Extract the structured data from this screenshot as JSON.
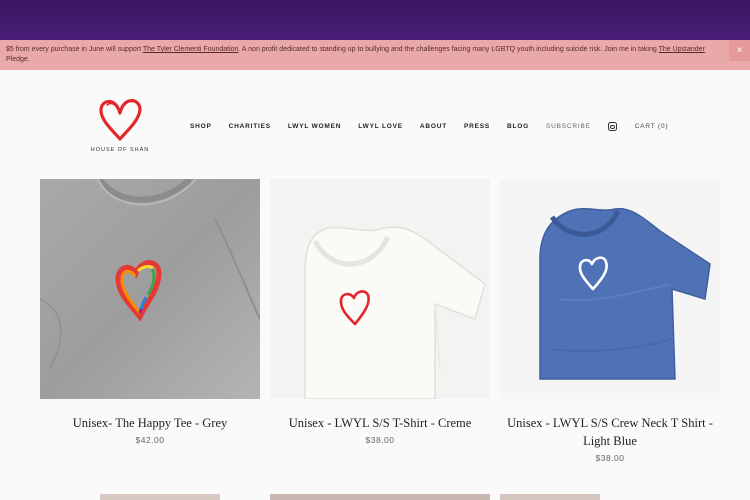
{
  "banner": {
    "text_before": "$5 from every purchase in June will support ",
    "link1": "The Tyler Clementi Foundation",
    "text_middle": ".  A non profit dedicated to standing up to bullying and the challenges facing many LGBTQ youth including suicide risk.  Join me in taking ",
    "link2": "The Upstander",
    "text_after": " Pledge.",
    "close": "×"
  },
  "logo": {
    "text": "HOUSE OF SHAN"
  },
  "nav": {
    "items": [
      "SHOP",
      "CHARITIES",
      "LWYL WOMEN",
      "LWYL LOVE",
      "ABOUT",
      "PRESS",
      "BLOG"
    ],
    "subscribe": "SUBSCRIBE",
    "instagram_icon": "instagram-icon",
    "cart": "CART (0)"
  },
  "products": [
    {
      "name": "Unisex- The Happy Tee - Grey",
      "price": "$42.00"
    },
    {
      "name": "Unisex - LWYL S/S T-Shirt - Creme",
      "price": "$38.00"
    },
    {
      "name": "Unisex - LWYL S/S Crew Neck T Shirt - Light Blue",
      "price": "$38.00"
    }
  ],
  "colors": {
    "banner_bg": "#eaa9a9",
    "topbar": "#3a1660",
    "heart_red": "#e3262b"
  }
}
